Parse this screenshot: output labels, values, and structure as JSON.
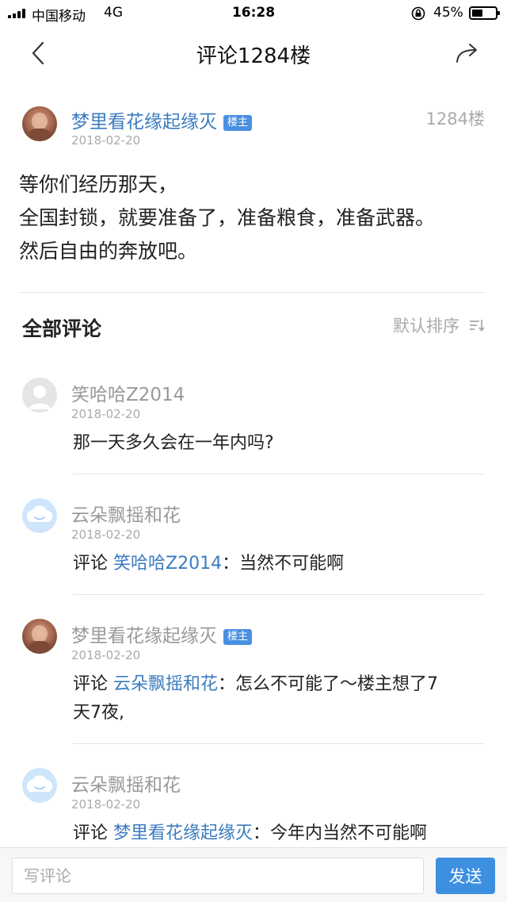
{
  "status_bar": {
    "carrier": "中国移动",
    "network": "4G",
    "time": "16:28",
    "battery_percent": "45%",
    "battery_level": 0.45
  },
  "nav": {
    "title": "评论1284楼",
    "back_icon": "chevron-left-icon",
    "share_icon": "share-arrow-icon"
  },
  "post": {
    "author": "梦里看花缘起缘灭",
    "badge": "楼主",
    "date": "2018-02-20",
    "floor": "1284楼",
    "lines": [
      "等你们经历那天，",
      "全国封锁，就要准备了，准备粮食，准备武器。",
      "然后自由的奔放吧。"
    ]
  },
  "comments_header": {
    "title": "全部评论",
    "sort_label": "默认排序",
    "sort_icon": "sort-icon"
  },
  "comments": [
    {
      "author": "笑哈哈Z2014",
      "date": "2018-02-20",
      "text": "那一天多久会在一年内吗?"
    },
    {
      "author": "云朵飘摇和花",
      "date": "2018-02-20",
      "prefix": "评论 ",
      "mention": "笑哈哈Z2014",
      "text": "：当然不可能啊"
    },
    {
      "author": "梦里看花缘起缘灭",
      "badge": "楼主",
      "date": "2018-02-20",
      "prefix": "评论 ",
      "mention": "云朵飘摇和花",
      "text_line1": "：怎么不可能了～楼主想了7",
      "text_line2": "天7夜,"
    },
    {
      "author": "云朵飘摇和花",
      "date": "2018-02-20",
      "prefix": "评论 ",
      "mention": "梦里看花缘起缘灭",
      "text": "：今年内当然不可能啊"
    }
  ],
  "input_bar": {
    "placeholder": "写评论",
    "send_label": "发送",
    "accent": "#3d8fe0"
  }
}
